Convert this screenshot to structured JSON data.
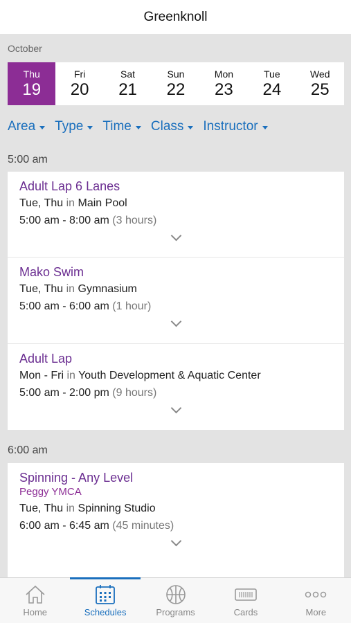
{
  "header": {
    "title": "Greenknoll"
  },
  "calendar": {
    "month": "October",
    "days": [
      {
        "name": "Thu",
        "num": "19"
      },
      {
        "name": "Fri",
        "num": "20"
      },
      {
        "name": "Sat",
        "num": "21"
      },
      {
        "name": "Sun",
        "num": "22"
      },
      {
        "name": "Mon",
        "num": "23"
      },
      {
        "name": "Tue",
        "num": "24"
      },
      {
        "name": "Wed",
        "num": "25"
      }
    ],
    "selected_index": 0
  },
  "filters": [
    "Area",
    "Type",
    "Time",
    "Class",
    "Instructor"
  ],
  "sections": [
    {
      "time": "5:00 am",
      "classes": [
        {
          "title": "Adult Lap 6 Lanes",
          "days": "Tue, Thu",
          "in": "in",
          "location": "Main Pool",
          "hours": "5:00 am - 8:00 am",
          "duration": "(3 hours)"
        },
        {
          "title": "Mako Swim",
          "days": "Tue, Thu",
          "in": "in",
          "location": "Gymnasium",
          "hours": "5:00 am - 6:00 am",
          "duration": "(1 hour)"
        },
        {
          "title": "Adult Lap",
          "days": "Mon - Fri",
          "in": "in",
          "location": "Youth Development & Aquatic Center",
          "hours": "5:00 am - 2:00 pm",
          "duration": "(9 hours)"
        }
      ]
    },
    {
      "time": "6:00 am",
      "classes": [
        {
          "title": "Spinning - Any Level",
          "instructor": "Peggy YMCA",
          "days": "Tue, Thu",
          "in": "in",
          "location": "Spinning Studio",
          "hours": "6:00 am - 6:45 am",
          "duration": "(45 minutes)"
        }
      ]
    }
  ],
  "tabbar": {
    "tabs": [
      {
        "label": "Home",
        "icon": "home-icon"
      },
      {
        "label": "Schedules",
        "icon": "calendar-icon"
      },
      {
        "label": "Programs",
        "icon": "basketball-icon"
      },
      {
        "label": "Cards",
        "icon": "card-icon"
      },
      {
        "label": "More",
        "icon": "more-icon"
      }
    ],
    "active_index": 1
  },
  "colors": {
    "accent": "#8c2d95",
    "link": "#1a6fbd"
  }
}
